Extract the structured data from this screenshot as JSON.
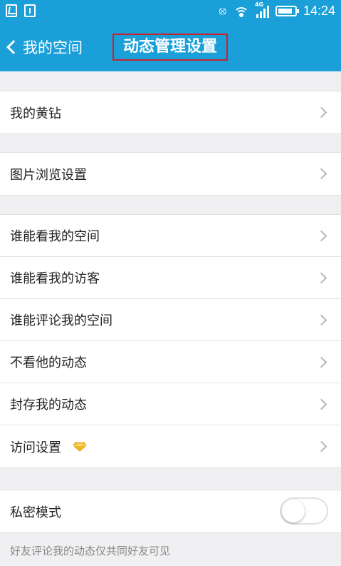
{
  "status_bar": {
    "time": "14:24",
    "network": "4G",
    "icons": [
      "image-icon",
      "sim-icon",
      "vibrate-icon",
      "wifi-icon",
      "signal-icon",
      "battery-icon"
    ]
  },
  "header": {
    "back_label": "我的空间",
    "title": "动态管理设置",
    "title_highlight_color": "#c8232c",
    "bar_color": "#1a9fd9"
  },
  "groups": [
    {
      "items": [
        {
          "label": "我的黄钻"
        }
      ]
    },
    {
      "items": [
        {
          "label": "图片浏览设置"
        }
      ]
    },
    {
      "items": [
        {
          "label": "谁能看我的空间"
        },
        {
          "label": "谁能看我的访客"
        },
        {
          "label": "谁能评论我的空间"
        },
        {
          "label": "不看他的动态"
        },
        {
          "label": "封存我的动态"
        },
        {
          "label": "访问设置",
          "badge_icon": "yellow-diamond-icon"
        }
      ]
    },
    {
      "items": [
        {
          "label": "私密模式",
          "toggle_on": false
        }
      ]
    }
  ],
  "footnote": "好友评论我的动态仅共同好友可见"
}
